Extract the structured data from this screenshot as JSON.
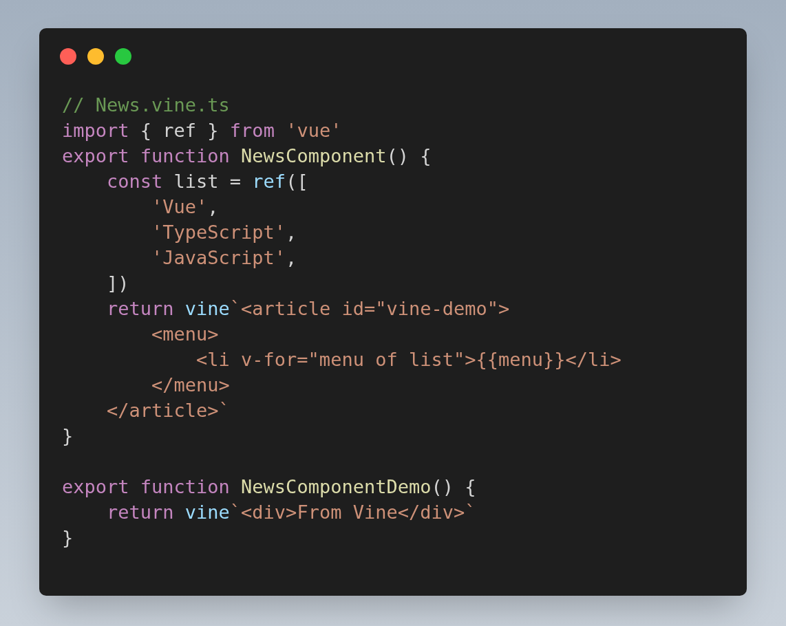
{
  "window": {
    "controls": [
      {
        "color": "#ff5f57"
      },
      {
        "color": "#febc2e"
      },
      {
        "color": "#28c840"
      }
    ]
  },
  "code": [
    {
      "kind": "code",
      "tokens": [
        {
          "kind": "comment",
          "text": "// News.vine.ts"
        }
      ]
    },
    {
      "kind": "code",
      "tokens": [
        {
          "kind": "keyword",
          "text": "import"
        },
        {
          "kind": "plain",
          "text": " { ref } "
        },
        {
          "kind": "keyword",
          "text": "from"
        },
        {
          "kind": "string",
          "text": " 'vue'"
        }
      ]
    },
    {
      "kind": "code",
      "tokens": [
        {
          "kind": "keyword",
          "text": "export function"
        },
        {
          "kind": "func",
          "text": " NewsComponent"
        },
        {
          "kind": "plain",
          "text": "() {"
        }
      ]
    },
    {
      "kind": "code",
      "tokens": [
        {
          "kind": "keyword",
          "text": "    const"
        },
        {
          "kind": "plain",
          "text": " list = "
        },
        {
          "kind": "var",
          "text": "ref"
        },
        {
          "kind": "plain",
          "text": "(["
        }
      ]
    },
    {
      "kind": "code",
      "tokens": [
        {
          "kind": "string",
          "text": "        'Vue'"
        },
        {
          "kind": "plain",
          "text": ","
        }
      ]
    },
    {
      "kind": "code",
      "tokens": [
        {
          "kind": "string",
          "text": "        'TypeScript'"
        },
        {
          "kind": "plain",
          "text": ","
        }
      ]
    },
    {
      "kind": "code",
      "tokens": [
        {
          "kind": "string",
          "text": "        'JavaScript'"
        },
        {
          "kind": "plain",
          "text": ","
        }
      ]
    },
    {
      "kind": "code",
      "tokens": [
        {
          "kind": "plain",
          "text": "    ])"
        }
      ]
    },
    {
      "kind": "code",
      "tokens": [
        {
          "kind": "keyword",
          "text": "    return"
        },
        {
          "kind": "var",
          "text": " vine"
        },
        {
          "kind": "string",
          "text": "`<article id=\"vine-demo\">"
        }
      ]
    },
    {
      "kind": "code",
      "tokens": [
        {
          "kind": "string",
          "text": "        <menu>"
        }
      ]
    },
    {
      "kind": "code",
      "tokens": [
        {
          "kind": "string",
          "text": "            <li v-for=\"menu of list\">{{menu}}</li>"
        }
      ]
    },
    {
      "kind": "code",
      "tokens": [
        {
          "kind": "string",
          "text": "        </menu>"
        }
      ]
    },
    {
      "kind": "code",
      "tokens": [
        {
          "kind": "string",
          "text": "    </article>`"
        }
      ]
    },
    {
      "kind": "code",
      "tokens": [
        {
          "kind": "plain",
          "text": "}"
        }
      ]
    },
    {
      "kind": "blank"
    },
    {
      "kind": "code",
      "tokens": [
        {
          "kind": "keyword",
          "text": "export function"
        },
        {
          "kind": "func",
          "text": " NewsComponentDemo"
        },
        {
          "kind": "plain",
          "text": "() {"
        }
      ]
    },
    {
      "kind": "code",
      "tokens": [
        {
          "kind": "keyword",
          "text": "    return"
        },
        {
          "kind": "var",
          "text": " vine"
        },
        {
          "kind": "string",
          "text": "`<div>From Vine</div>`"
        }
      ]
    },
    {
      "kind": "code",
      "tokens": [
        {
          "kind": "plain",
          "text": "}"
        }
      ]
    }
  ]
}
